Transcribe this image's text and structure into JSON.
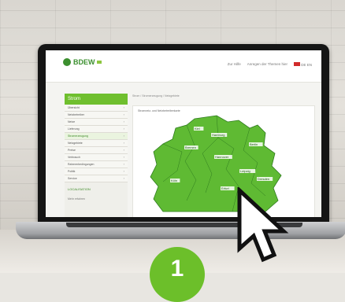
{
  "header": {
    "logo_text": "BDEW",
    "links": [
      "Zur Hilfe",
      "Anregen der Themen hier",
      "DE EN"
    ]
  },
  "sidebar": {
    "title": "Strom",
    "items": [
      {
        "label": "Übersicht"
      },
      {
        "label": "Netzbetreiber"
      },
      {
        "label": "Netze"
      },
      {
        "label": "Lieferung"
      },
      {
        "label": "Stromerzeugung",
        "active": true
      },
      {
        "label": "Netzgebiete"
      },
      {
        "label": "Preise"
      },
      {
        "label": "Verbrauch"
      },
      {
        "label": "Rahmenbedingungen"
      },
      {
        "label": "Politik"
      },
      {
        "label": "Service"
      }
    ],
    "bottom_link": "LOCALISATION",
    "bottom_note": "Mehr erfahren"
  },
  "main": {
    "breadcrumb": "Strom / Stromerzeugung / Netzgebiete",
    "map_caption": "Stromnetz- und Netzbetreiberkarte"
  },
  "map_labels": [
    "Kiel",
    "Hamburg",
    "Bremen",
    "Berlin",
    "Hannover",
    "Leipzig",
    "Dresden",
    "Köln",
    "Erfurt"
  ],
  "step_badge": "1",
  "colors": {
    "accent": "#6cbf2a",
    "map_green": "#5fba33",
    "map_dark": "#2e7b1f"
  }
}
